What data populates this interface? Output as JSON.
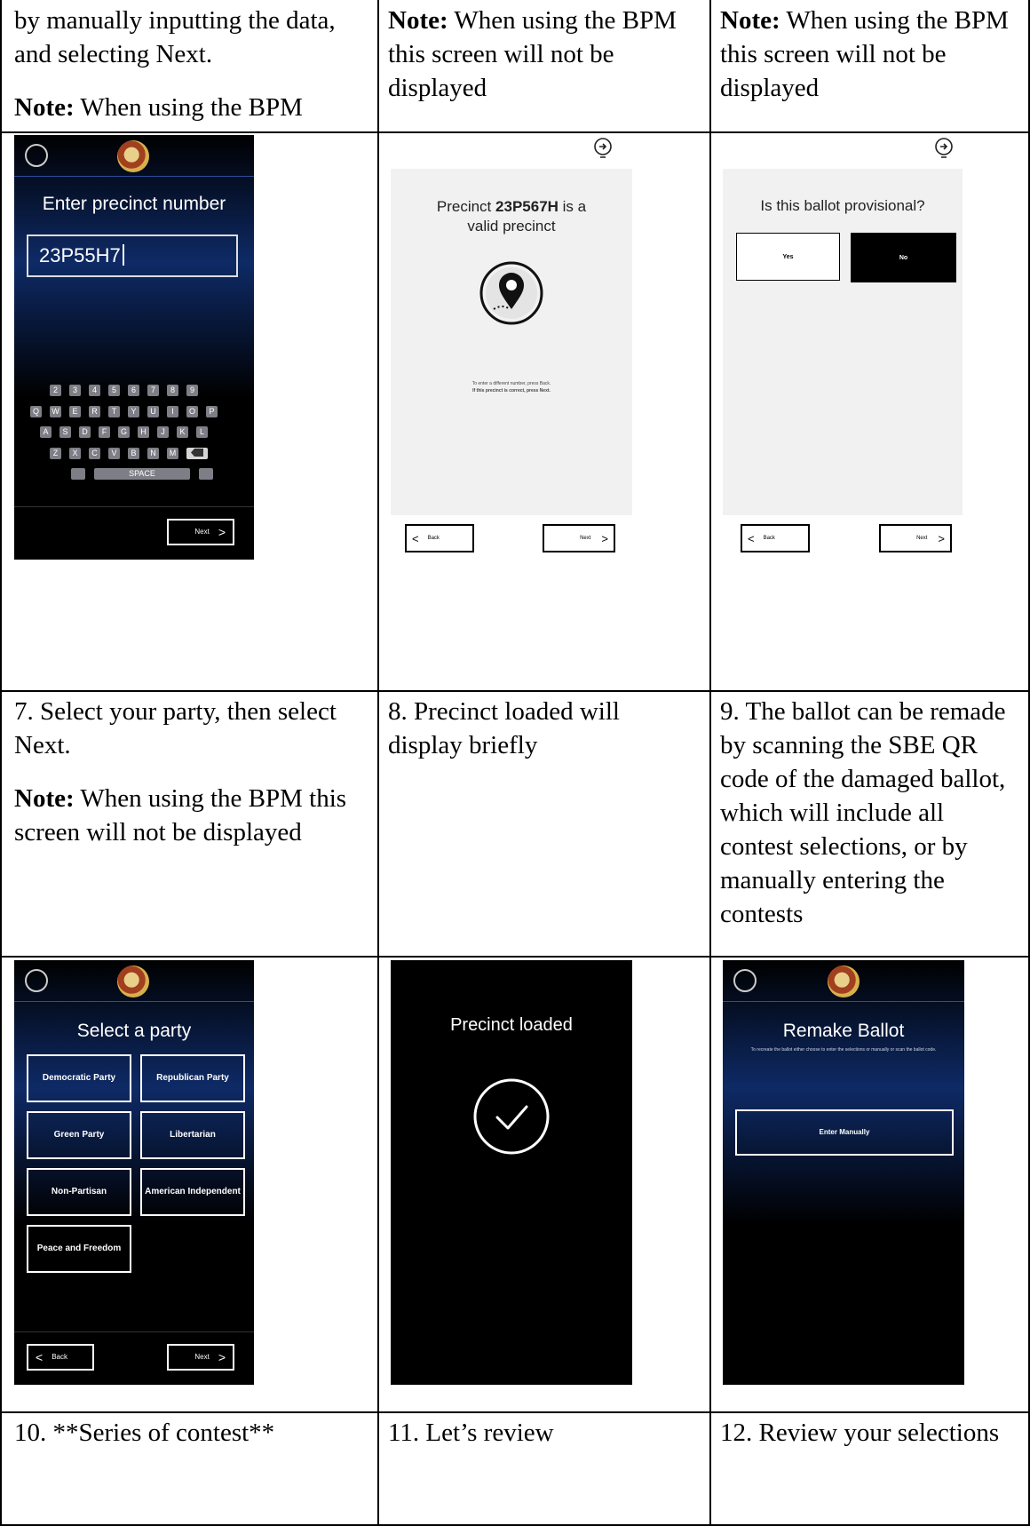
{
  "row1": {
    "c1": {
      "text": "by manually inputting the data, and selecting Next.",
      "note_label": "Note:",
      "note_text": "When using the BPM"
    },
    "c2": {
      "note_label": "Note:",
      "note_text": "When using the BPM this screen will not be displayed"
    },
    "c3": {
      "note_label": "Note:",
      "note_text": "When using the BPM this screen will not be displayed"
    }
  },
  "screen_precinct_entry": {
    "title": "Enter precinct number",
    "input_value": "23P55H7",
    "keys_row1": [
      "2",
      "3",
      "4",
      "5",
      "6",
      "7",
      "8",
      "9"
    ],
    "keys_row2": [
      "Q",
      "W",
      "E",
      "R",
      "T",
      "Y",
      "U",
      "I",
      "O",
      "P"
    ],
    "keys_row3": [
      "A",
      "S",
      "D",
      "F",
      "G",
      "H",
      "J",
      "K",
      "L"
    ],
    "keys_row4": [
      "Z",
      "X",
      "C",
      "V",
      "B",
      "N",
      "M"
    ],
    "space_label": "SPACE",
    "next_label": "Next"
  },
  "screen_valid_precinct": {
    "title_prefix": "Precinct",
    "precinct_id": "23P567H",
    "title_suffix": "is a",
    "title_line2": "valid precinct",
    "hint_line1": "To enter a different number, press Back.",
    "hint_line2": "If this precinct is correct, press Next.",
    "back_label": "Back",
    "next_label": "Next"
  },
  "screen_provisional": {
    "question": "Is this ballot provisional?",
    "yes_label": "Yes",
    "no_label": "No",
    "back_label": "Back",
    "next_label": "Next"
  },
  "row3": {
    "c1": {
      "step": "7. Select your party, then select Next.",
      "note_label": "Note:",
      "note_text": "When using the BPM this screen will not be displayed"
    },
    "c2": {
      "step": "8. Precinct loaded will display briefly"
    },
    "c3": {
      "step": "9. The ballot can be remade by scanning the SBE QR code of the damaged ballot, which will include all contest selections, or by manually entering the contests"
    }
  },
  "screen_party": {
    "title": "Select a party",
    "parties": [
      "Democratic Party",
      "Republican Party",
      "Green Party",
      "Libertarian",
      "Non-Partisan",
      "American Independent",
      "Peace and Freedom"
    ],
    "back_label": "Back",
    "next_label": "Next"
  },
  "screen_loaded": {
    "title": "Precinct loaded"
  },
  "screen_remake": {
    "title": "Remake Ballot",
    "subtitle": "To recreate the ballot either choose to enter the selections or manually or scan the ballot code.",
    "enter_manually_label": "Enter Manually"
  },
  "row5": {
    "c1": "10. **Series of contest**",
    "c2": "11. Let’s review",
    "c3": "12. Review your selections"
  }
}
